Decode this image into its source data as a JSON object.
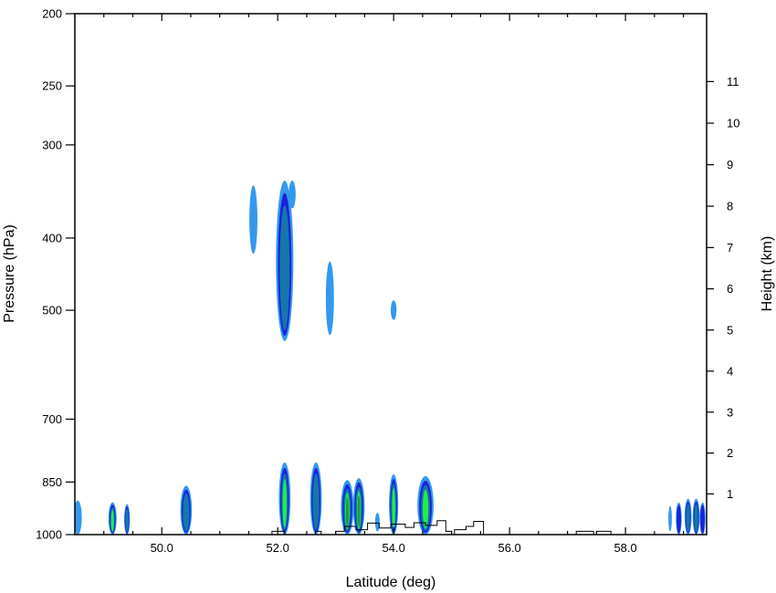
{
  "chart_data": {
    "type": "contour",
    "title": "",
    "xlabel": "Latitude (deg)",
    "ylabel_left": "Pressure (hPa)",
    "ylabel_right": "Height (km)",
    "xlim": [
      48.5,
      59.4
    ],
    "x_ticks": [
      {
        "value": 50,
        "label": "50.0"
      },
      {
        "value": 52,
        "label": "52.0"
      },
      {
        "value": 54,
        "label": "54.0"
      },
      {
        "value": 56,
        "label": "56.0"
      },
      {
        "value": 58,
        "label": "58.0"
      }
    ],
    "x_minor_step": 0.5,
    "y_pressure_scale": "log",
    "y_pressure_range": [
      1000,
      200
    ],
    "y_pressure_ticks": [
      200,
      250,
      300,
      400,
      500,
      700,
      850,
      1000
    ],
    "y_height_ticks": [
      1,
      2,
      3,
      4,
      5,
      6,
      7,
      8,
      9,
      10,
      11
    ],
    "grid": false,
    "levels": [
      {
        "color": "#3399ee"
      },
      {
        "color": "#1a22dd"
      },
      {
        "color": "#1577a8"
      },
      {
        "color": "#22ee44"
      },
      {
        "color": "#1a9a3a"
      }
    ],
    "cells": [
      {
        "lat": 51.58,
        "p_top": 340,
        "p_bot": 420,
        "halfwidth": 0.07,
        "levels": 1
      },
      {
        "lat": 52.12,
        "p_top": 335,
        "p_bot": 550,
        "halfwidth": 0.15,
        "levels": 3
      },
      {
        "lat": 52.25,
        "p_top": 335,
        "p_bot": 365,
        "halfwidth": 0.06,
        "levels": 1
      },
      {
        "lat": 52.9,
        "p_top": 430,
        "p_bot": 540,
        "halfwidth": 0.07,
        "levels": 1
      },
      {
        "lat": 54.0,
        "p_top": 485,
        "p_bot": 515,
        "halfwidth": 0.05,
        "levels": 1
      },
      {
        "lat": 48.55,
        "p_top": 900,
        "p_bot": 1000,
        "halfwidth": 0.07,
        "levels": 1
      },
      {
        "lat": 49.15,
        "p_top": 905,
        "p_bot": 1000,
        "halfwidth": 0.07,
        "levels": 4
      },
      {
        "lat": 49.4,
        "p_top": 910,
        "p_bot": 1000,
        "halfwidth": 0.05,
        "levels": 3
      },
      {
        "lat": 50.42,
        "p_top": 860,
        "p_bot": 1000,
        "halfwidth": 0.1,
        "levels": 3
      },
      {
        "lat": 52.12,
        "p_top": 800,
        "p_bot": 1000,
        "halfwidth": 0.1,
        "levels": 4
      },
      {
        "lat": 52.66,
        "p_top": 800,
        "p_bot": 1000,
        "halfwidth": 0.1,
        "levels": 3
      },
      {
        "lat": 53.2,
        "p_top": 845,
        "p_bot": 1000,
        "halfwidth": 0.11,
        "levels": 5
      },
      {
        "lat": 53.4,
        "p_top": 840,
        "p_bot": 1000,
        "halfwidth": 0.1,
        "levels": 5
      },
      {
        "lat": 53.72,
        "p_top": 935,
        "p_bot": 990,
        "halfwidth": 0.04,
        "levels": 1
      },
      {
        "lat": 54.0,
        "p_top": 830,
        "p_bot": 1000,
        "halfwidth": 0.08,
        "levels": 4
      },
      {
        "lat": 54.55,
        "p_top": 835,
        "p_bot": 1000,
        "halfwidth": 0.14,
        "levels": 4
      },
      {
        "lat": 58.77,
        "p_top": 915,
        "p_bot": 990,
        "halfwidth": 0.03,
        "levels": 1
      },
      {
        "lat": 58.92,
        "p_top": 905,
        "p_bot": 1000,
        "halfwidth": 0.05,
        "levels": 2
      },
      {
        "lat": 59.08,
        "p_top": 895,
        "p_bot": 1000,
        "halfwidth": 0.06,
        "levels": 3
      },
      {
        "lat": 59.22,
        "p_top": 895,
        "p_bot": 1000,
        "halfwidth": 0.06,
        "levels": 3
      },
      {
        "lat": 59.33,
        "p_top": 905,
        "p_bot": 1000,
        "halfwidth": 0.05,
        "levels": 2
      }
    ],
    "terrain_line": [
      [
        51.9,
        1000
      ],
      [
        51.9,
        990
      ],
      [
        52.12,
        990
      ],
      [
        52.12,
        1000
      ],
      [
        52.65,
        1000
      ],
      [
        52.65,
        990
      ],
      [
        52.75,
        990
      ],
      [
        52.75,
        1000
      ],
      [
        53.0,
        1000
      ],
      [
        53.0,
        990
      ],
      [
        53.15,
        990
      ],
      [
        53.15,
        975
      ],
      [
        53.35,
        975
      ],
      [
        53.35,
        985
      ],
      [
        53.55,
        985
      ],
      [
        53.55,
        965
      ],
      [
        53.75,
        965
      ],
      [
        53.75,
        980
      ],
      [
        53.95,
        980
      ],
      [
        53.95,
        968
      ],
      [
        54.2,
        968
      ],
      [
        54.2,
        978
      ],
      [
        54.35,
        978
      ],
      [
        54.35,
        964
      ],
      [
        54.55,
        964
      ],
      [
        54.55,
        972
      ],
      [
        54.75,
        972
      ],
      [
        54.75,
        958
      ],
      [
        54.9,
        958
      ],
      [
        54.9,
        990
      ],
      [
        55.0,
        990
      ],
      [
        55.0,
        1000
      ],
      [
        55.05,
        1000
      ],
      [
        55.05,
        985
      ],
      [
        55.25,
        985
      ],
      [
        55.25,
        975
      ],
      [
        55.38,
        975
      ],
      [
        55.38,
        960
      ],
      [
        55.55,
        960
      ],
      [
        55.55,
        1000
      ],
      [
        57.15,
        1000
      ],
      [
        57.15,
        990
      ],
      [
        57.45,
        990
      ],
      [
        57.45,
        1000
      ],
      [
        57.5,
        1000
      ],
      [
        57.5,
        990
      ],
      [
        57.75,
        990
      ],
      [
        57.75,
        1000
      ]
    ]
  }
}
